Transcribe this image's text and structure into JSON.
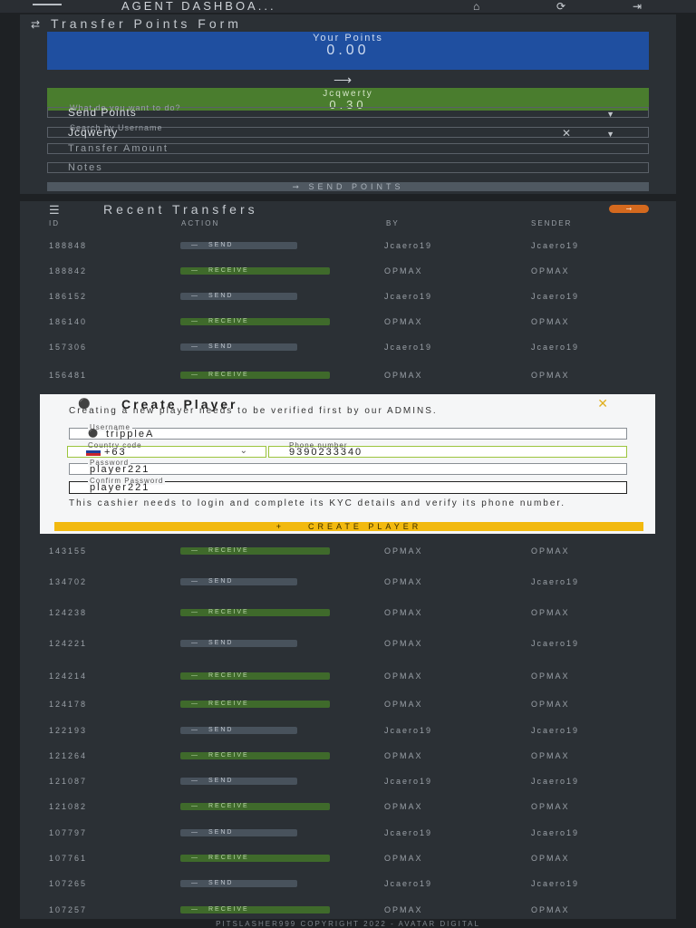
{
  "header": {
    "title": "AGENT DASHBOA...",
    "icons": [
      "menu-icon",
      "home-icon",
      "refresh-icon",
      "logout-icon"
    ]
  },
  "transfer_form": {
    "title": "Transfer Points Form",
    "your_points_label": "Your Points",
    "your_points_value": "0.00",
    "target_label": "Jcqwerty",
    "target_value": "0.30",
    "action_label": "What do you want to do?",
    "action_value": "Send Points",
    "search_label": "Search by Username",
    "search_value": "Jcqwerty",
    "amount_placeholder": "Transfer Amount",
    "notes_placeholder": "Notes",
    "send_button": "SEND POINTS"
  },
  "recent_transfers": {
    "title": "Recent Transfers",
    "columns": [
      "ID",
      "ACTION",
      "BY",
      "SENDER"
    ],
    "rows": [
      {
        "id": "188848",
        "action": "SEND",
        "by": "Jcaero19",
        "sender": "Jcaero19"
      },
      {
        "id": "188842",
        "action": "RECEIVE",
        "by": "OPMAX",
        "sender": "OPMAX"
      },
      {
        "id": "186152",
        "action": "SEND",
        "by": "Jcaero19",
        "sender": "Jcaero19"
      },
      {
        "id": "186140",
        "action": "RECEIVE",
        "by": "OPMAX",
        "sender": "OPMAX"
      },
      {
        "id": "157306",
        "action": "SEND",
        "by": "Jcaero19",
        "sender": "Jcaero19"
      },
      {
        "id": "156481",
        "action": "RECEIVE",
        "by": "OPMAX",
        "sender": "OPMAX"
      },
      {
        "id": "143155",
        "action": "RECEIVE",
        "by": "OPMAX",
        "sender": "OPMAX"
      },
      {
        "id": "134702",
        "action": "SEND",
        "by": "OPMAX",
        "sender": "Jcaero19"
      },
      {
        "id": "124238",
        "action": "RECEIVE",
        "by": "OPMAX",
        "sender": "OPMAX"
      },
      {
        "id": "124221",
        "action": "SEND",
        "by": "OPMAX",
        "sender": "Jcaero19"
      },
      {
        "id": "124214",
        "action": "RECEIVE",
        "by": "OPMAX",
        "sender": "OPMAX"
      },
      {
        "id": "124178",
        "action": "RECEIVE",
        "by": "OPMAX",
        "sender": "OPMAX"
      },
      {
        "id": "122193",
        "action": "SEND",
        "by": "Jcaero19",
        "sender": "Jcaero19"
      },
      {
        "id": "121264",
        "action": "RECEIVE",
        "by": "OPMAX",
        "sender": "OPMAX"
      },
      {
        "id": "121087",
        "action": "SEND",
        "by": "Jcaero19",
        "sender": "Jcaero19"
      },
      {
        "id": "121082",
        "action": "RECEIVE",
        "by": "OPMAX",
        "sender": "OPMAX"
      },
      {
        "id": "107797",
        "action": "SEND",
        "by": "Jcaero19",
        "sender": "Jcaero19"
      },
      {
        "id": "107761",
        "action": "RECEIVE",
        "by": "OPMAX",
        "sender": "OPMAX"
      },
      {
        "id": "107265",
        "action": "SEND",
        "by": "Jcaero19",
        "sender": "Jcaero19"
      },
      {
        "id": "107257",
        "action": "RECEIVE",
        "by": "OPMAX",
        "sender": "OPMAX"
      }
    ]
  },
  "create_player_modal": {
    "title": "Create Player",
    "description": "Creating a new player needs to be verified first by our ADMINS.",
    "username_label": "Username",
    "username_value": "trippleA",
    "country_code_label": "Country code",
    "country_code_value": "+63",
    "phone_label": "Phone number",
    "phone_value": "9390233340",
    "password_label": "Password",
    "password_value": "player221",
    "confirm_password_label": "Confirm Password",
    "confirm_password_value": "player221",
    "note": "This cashier needs to login and complete its KYC details and verify its phone number.",
    "create_button": "CREATE PLAYER"
  },
  "footer": {
    "text": "PITSLASHER999 COPYRIGHT 2022 - AVATAR DIGITAL"
  }
}
